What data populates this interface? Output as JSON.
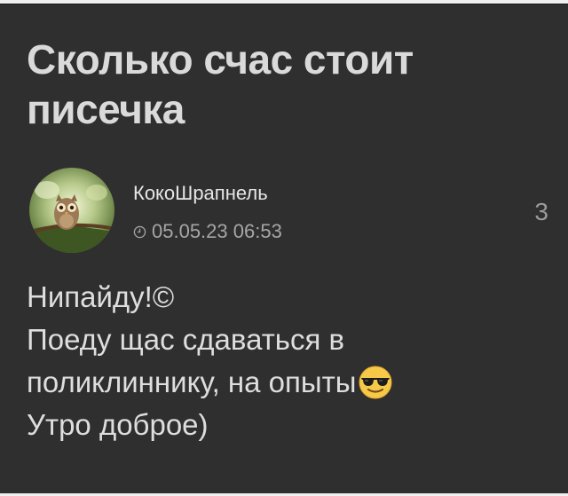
{
  "post": {
    "title": "Сколько счас стоит писечка",
    "author": {
      "name": "КокоШрапнель",
      "avatar_icon": "owl-avatar"
    },
    "date_icon": "clock-icon",
    "datetime": "05.05.23 06:53",
    "comment_count": "3",
    "body": {
      "line1": "Нипайду!©",
      "line2": "Поеду щас сдаваться в",
      "line3": "поликлиннику, на опыты",
      "line3_emoji": "smiling-face-with-sunglasses-icon",
      "line4": "Утро доброе)"
    }
  },
  "colors": {
    "card_background": "#2f2f2f",
    "page_background": "#f0f0f0",
    "title": "#dadada",
    "body_text": "#dedede",
    "meta_text": "#a6a6a6"
  }
}
